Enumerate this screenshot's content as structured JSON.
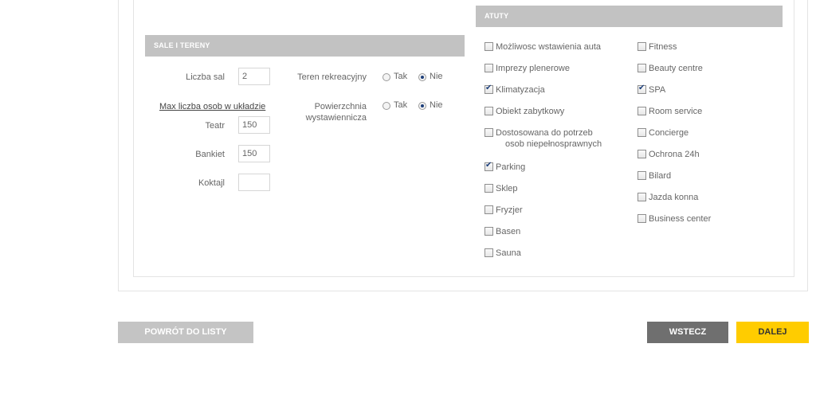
{
  "sale_tereny": {
    "header": "SALE I TERENY",
    "liczba_sal_label": "Liczba sal",
    "liczba_sal_value": "2",
    "max_liczba_label": "Max liczba osob w układzie",
    "teatr_label": "Teatr",
    "teatr_value": "150",
    "bankiet_label": "Bankiet",
    "bankiet_value": "150",
    "koktajl_label": "Koktajl",
    "koktajl_value": "",
    "teren_label": "Teren rekreacyjny",
    "powierzchnia_label_line1": "Powierzchnia",
    "powierzchnia_label_line2": "wystawiennicza",
    "tak_label": "Tak",
    "nie_label": "Nie",
    "teren_selected": "Nie",
    "powierzchnia_selected": "Nie"
  },
  "atuty": {
    "header": "ATUTY",
    "col1": [
      {
        "label": "Możliwosc wstawienia auta",
        "checked": false
      },
      {
        "label": "Imprezy plenerowe",
        "checked": false
      },
      {
        "label": "Klimatyzacja",
        "checked": true
      },
      {
        "label": "Obiekt zabytkowy",
        "checked": false
      },
      {
        "label": "Dostosowana do potrzeb",
        "label2": "osob niepełnosprawnych",
        "checked": false
      },
      {
        "label": "Parking",
        "checked": true
      },
      {
        "label": "Sklep",
        "checked": false
      },
      {
        "label": "Fryzjer",
        "checked": false
      },
      {
        "label": "Basen",
        "checked": false
      },
      {
        "label": "Sauna",
        "checked": false
      }
    ],
    "col2": [
      {
        "label": "Fitness",
        "checked": false
      },
      {
        "label": "Beauty centre",
        "checked": false
      },
      {
        "label": "SPA",
        "checked": true
      },
      {
        "label": "Room service",
        "checked": false
      },
      {
        "label": "Concierge",
        "checked": false
      },
      {
        "label": "Ochrona 24h",
        "checked": false
      },
      {
        "label": "Bilard",
        "checked": false
      },
      {
        "label": "Jazda konna",
        "checked": false
      },
      {
        "label": "Business center",
        "checked": false
      }
    ]
  },
  "buttons": {
    "back_to_list": "POWRÓT DO LISTY",
    "prev": "WSTECZ",
    "next": "DALEJ"
  },
  "colors": {
    "header_bg": "#c2c2c2",
    "next_button": "#ffcc00",
    "prev_button": "#6f6f6f",
    "back_button": "#c4c4c4"
  }
}
